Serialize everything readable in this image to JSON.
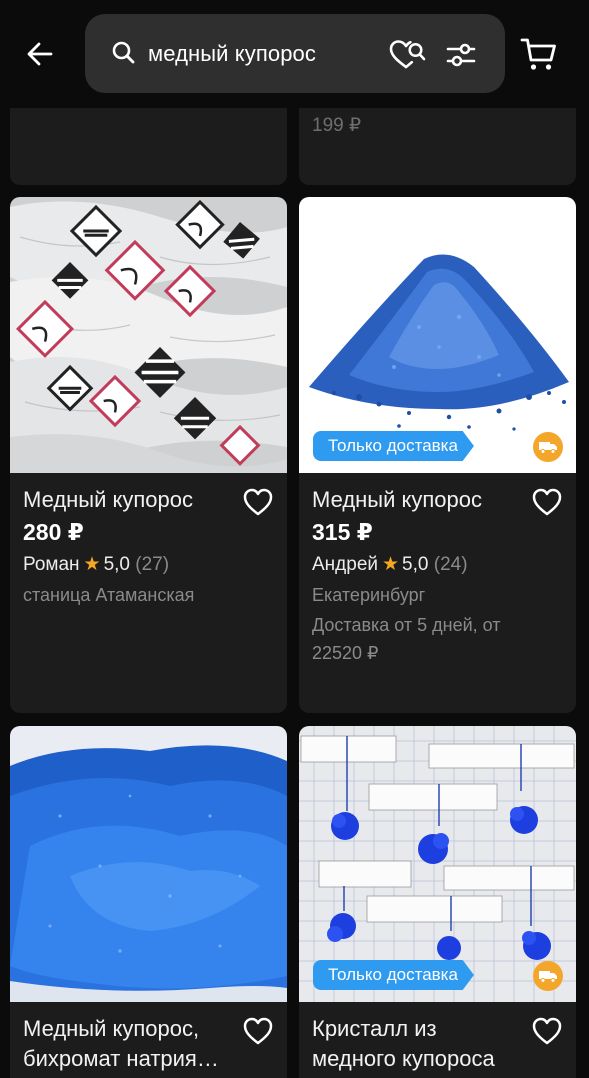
{
  "search": {
    "query": "медный купорос"
  },
  "prev_row": {
    "right_price": "199 ₽"
  },
  "colors": {
    "background": "#0b0b0b",
    "card": "#1c1c1c",
    "accent_blue": "#2f9bf0",
    "star": "#f5a623",
    "delivery_icon": "#f4a62a"
  },
  "products": [
    {
      "title": "Медный купорос",
      "price": "280 ₽",
      "seller": "Роман",
      "rating": "5,0",
      "reviews": "(27)",
      "location": "станица Атаманская",
      "image": "bags-with-hazard-labels"
    },
    {
      "title": "Медный купорос",
      "price": "315 ₽",
      "seller": "Андрей",
      "rating": "5,0",
      "reviews": "(24)",
      "location": "Екатеринбург",
      "delivery": "Доставка от 5 дней, от 22520 ₽",
      "badge": "Только доставка",
      "image": "blue-crystal-pile"
    },
    {
      "title": "Медный купорос, бихромат натрия…",
      "image": "blue-powder"
    },
    {
      "title": "Кристалл из медного купороса",
      "badge": "Только доставка",
      "image": "crystals-on-threads"
    }
  ]
}
